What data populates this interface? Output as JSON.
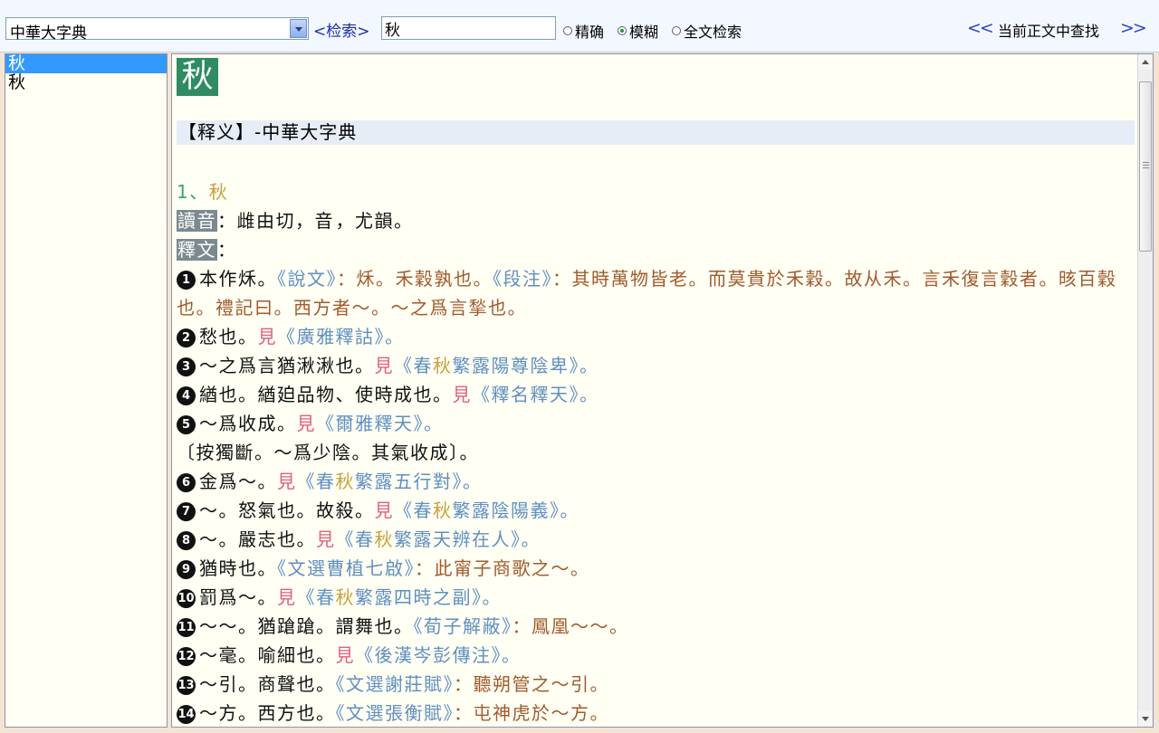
{
  "toolbar": {
    "dictionary": "中華大字典",
    "search_label": "<检索>",
    "search_value": "秋",
    "modes": [
      {
        "label": "精确",
        "selected": false
      },
      {
        "label": "模糊",
        "selected": true
      },
      {
        "label": "全文检索",
        "selected": false
      }
    ],
    "prev_label": "<<",
    "find_label": "当前正文中查找",
    "next_label": ">>"
  },
  "results": [
    "秋",
    "秋"
  ],
  "entry": {
    "head_char": "秋",
    "section_header": "【释义】-中華大字典",
    "index": "1、",
    "headword": "秋",
    "reading_label": "讀音",
    "reading_text": "：雌由切，音𩺶，尤韻。",
    "meaning_label": "釋文",
    "meaning_colon": "：",
    "senses": [
      {
        "num": "1",
        "text": "本作秌。",
        "ref": "《說文》",
        "colon": "：",
        "quote": "秌。禾穀孰也。",
        "ref2": "《段注》",
        "colon2": "：",
        "quote2": "其時萬物皆老。而莫貴於禾穀。故从禾。言禾復言穀者。晐百穀也。禮記曰。西方者～。～之爲言揫也。"
      },
      {
        "num": "2",
        "text": "愁也。",
        "see": "見",
        "ref": "《廣雅釋詁》。"
      },
      {
        "num": "3",
        "text": "～之爲言猶湫湫也。",
        "see": "見",
        "ref_a": "《春",
        "gold": "秋",
        "ref_b": "繁露陽尊陰卑》。"
      },
      {
        "num": "4",
        "text": "緧也。緧廹品物、使時成也。",
        "see": "見",
        "ref": "《釋名釋天》。"
      },
      {
        "num": "5",
        "text": "～爲收成。",
        "see": "見",
        "ref": "《爾雅釋天》。"
      },
      {
        "note": "〔按獨斷。～爲少陰。其氣收成〕。"
      },
      {
        "num": "6",
        "text": "金爲～。",
        "see": "見",
        "ref_a": "《春",
        "gold": "秋",
        "ref_b": "繁露五行對》。"
      },
      {
        "num": "7",
        "text": "～。怒氣也。故殺。",
        "see": "見",
        "ref_a": "《春",
        "gold": "秋",
        "ref_b": "繁露陰陽義》。"
      },
      {
        "num": "8",
        "text": "～。嚴志也。",
        "see": "見",
        "ref_a": "《春",
        "gold": "秋",
        "ref_b": "繁露天辨在人》。"
      },
      {
        "num": "9",
        "text": "猶時也。",
        "ref": "《文選曹植七啟》",
        "colon": "：",
        "quote": "此甯子商歌之～。"
      },
      {
        "num": "10",
        "text": "罰爲～。",
        "see": "見",
        "ref_a": "《春",
        "gold": "秋",
        "ref_b": "繁露四時之副》。"
      },
      {
        "num": "11",
        "text": "～～。猶蹌蹌。謂舞也。",
        "ref": "《荀子解蔽》",
        "colon": "：",
        "quote": "鳳凰～～。"
      },
      {
        "num": "12",
        "text": "～毫。喻細也。",
        "see": "見",
        "ref": "《後漢岑彭傳注》。"
      },
      {
        "num": "13",
        "text": "～引。商聲也。",
        "ref": "《文選謝莊賦》",
        "colon": "：",
        "quote": "聽朔管之～引。"
      },
      {
        "num": "14",
        "text": "～方。西方也。",
        "ref": "《文選張衡賦》",
        "colon": "：",
        "quote": "屯神虎於～方。"
      }
    ]
  },
  "colors": {
    "head_char_bg": "#2e8b62",
    "selected_item": "#3399ff",
    "reference": "#5f8fc0",
    "quote": "#a05a2c",
    "see": "#e0607a",
    "gold": "#c9a03a"
  }
}
